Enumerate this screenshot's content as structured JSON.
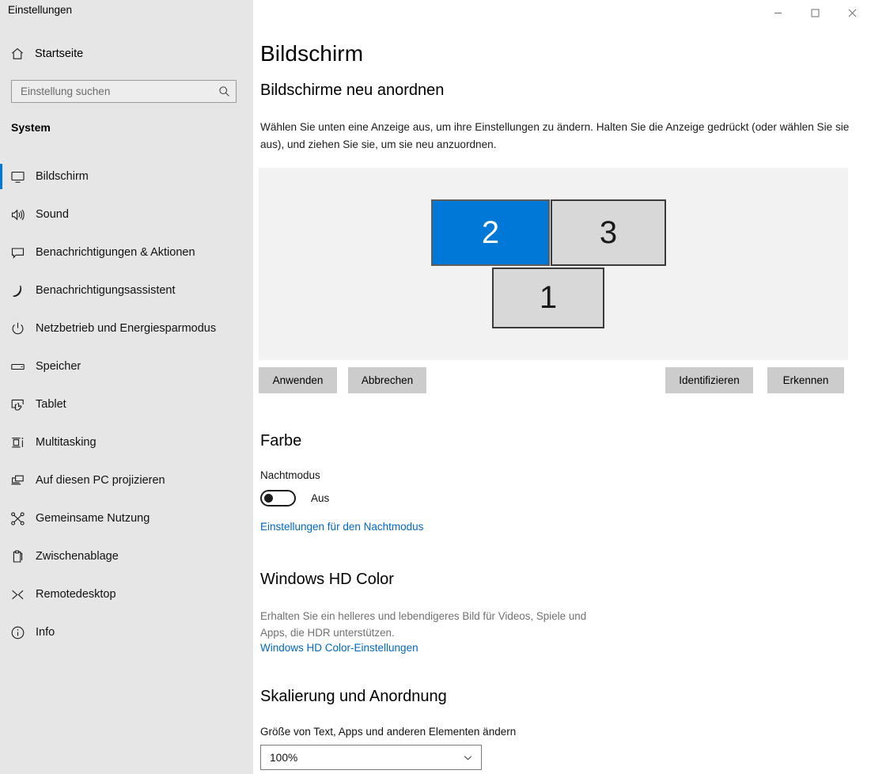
{
  "app": {
    "title": "Einstellungen"
  },
  "titlebar": {
    "minimize": {
      "name": "minimize-icon",
      "tooltip": "Minimieren"
    },
    "maximize": {
      "name": "maximize-icon",
      "tooltip": "Maximieren"
    },
    "close": {
      "name": "close-icon",
      "tooltip": "Schließen"
    }
  },
  "sidebar": {
    "home": {
      "label": "Startseite",
      "icon": "home-icon"
    },
    "search": {
      "value": "",
      "placeholder": "Einstellung suchen",
      "icon": "search-icon"
    },
    "group_title": "System",
    "items": [
      {
        "label": "Bildschirm",
        "icon": "monitor-icon",
        "selected": true
      },
      {
        "label": "Sound",
        "icon": "speaker-icon",
        "selected": false
      },
      {
        "label": "Benachrichtigungen & Aktionen",
        "icon": "chat-bubble-icon",
        "selected": false
      },
      {
        "label": "Benachrichtigungsassistent",
        "icon": "moon-icon",
        "selected": false
      },
      {
        "label": "Netzbetrieb und Energiesparmodus",
        "icon": "power-icon",
        "selected": false
      },
      {
        "label": "Speicher",
        "icon": "storage-icon",
        "selected": false
      },
      {
        "label": "Tablet",
        "icon": "tablet-touch-icon",
        "selected": false
      },
      {
        "label": "Multitasking",
        "icon": "multitasking-icon",
        "selected": false
      },
      {
        "label": "Auf diesen PC projizieren",
        "icon": "project-screen-icon",
        "selected": false
      },
      {
        "label": "Gemeinsame Nutzung",
        "icon": "share-nodes-icon",
        "selected": false
      },
      {
        "label": "Zwischenablage",
        "icon": "clipboard-icon",
        "selected": false
      },
      {
        "label": "Remotedesktop",
        "icon": "remote-desktop-icon",
        "selected": false
      },
      {
        "label": "Info",
        "icon": "info-circle-icon",
        "selected": false
      }
    ]
  },
  "main": {
    "page_title": "Bildschirm",
    "rearrange": {
      "heading": "Bildschirme neu anordnen",
      "description": "Wählen Sie unten eine Anzeige aus, um ihre Einstellungen zu ändern. Halten Sie die Anzeige gedrückt (oder wählen Sie sie aus), und ziehen Sie sie, um sie neu anzuordnen.",
      "monitors": [
        {
          "label": "2",
          "selected": true
        },
        {
          "label": "3",
          "selected": false
        },
        {
          "label": "1",
          "selected": false
        }
      ],
      "buttons": {
        "apply": "Anwenden",
        "cancel": "Abbrechen",
        "identify": "Identifizieren",
        "detect": "Erkennen"
      }
    },
    "color": {
      "heading": "Farbe",
      "night_light_label": "Nachtmodus",
      "night_light_state": "Aus",
      "night_light_link": "Einstellungen für den Nachtmodus"
    },
    "hdcolor": {
      "heading": "Windows HD Color",
      "description": "Erhalten Sie ein helleres und lebendigeres Bild für Videos, Spiele und Apps, die HDR unterstützen.",
      "link": "Windows HD Color-Einstellungen"
    },
    "scaling": {
      "heading": "Skalierung und Anordnung",
      "label": "Größe von Text, Apps und anderen Elementen ändern",
      "selected_value": "100%"
    }
  },
  "colors": {
    "accent": "#0078d7",
    "link": "#0067c0",
    "sidebar_bg": "#e6e6e6",
    "panel_bg": "#f2f2f2",
    "button_bg": "#cccccc"
  }
}
